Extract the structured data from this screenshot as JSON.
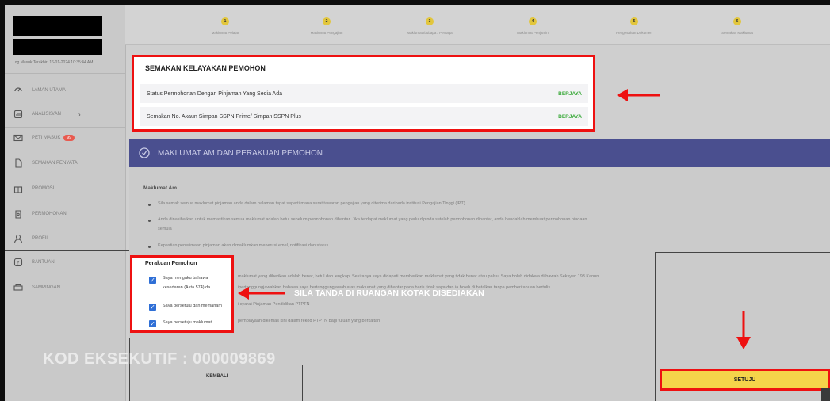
{
  "colors": {
    "accent_red": "#ee1111",
    "header_blue": "#4a4f8f",
    "success_green": "#3caa3c",
    "button_yellow": "#f5d44a",
    "checkbox_blue": "#2f6fd6"
  },
  "sidebar": {
    "last_login": "Log Masuk Terakhir: 16-01-2024 10:35:44 AM",
    "items": [
      {
        "label": "LAMAN UTAMA",
        "icon": "dashboard-icon"
      },
      {
        "label": "ANALISIS/AN",
        "icon": "chart-icon",
        "has_chevron": true
      },
      {
        "label": "PETI MASUK",
        "icon": "mail-icon",
        "badge": "99"
      },
      {
        "label": "SEMAKAN PENYATA",
        "icon": "document-icon"
      },
      {
        "label": "PROMOSI",
        "icon": "gift-icon"
      },
      {
        "label": "PERMOHONAN",
        "icon": "wallet-icon"
      },
      {
        "label": "PROFIL",
        "icon": "user-icon"
      },
      {
        "label": "BANTUAN",
        "icon": "help-icon"
      },
      {
        "label": "SAMPINGAN",
        "icon": "printer-icon"
      }
    ]
  },
  "stepper": {
    "steps": [
      {
        "num": "1",
        "label": "Maklumat Pelajar"
      },
      {
        "num": "2",
        "label": "Maklumat Pengajian"
      },
      {
        "num": "3",
        "label": "Maklumat Ibubapa / Penjaga"
      },
      {
        "num": "4",
        "label": "Maklumat Penjamin"
      },
      {
        "num": "5",
        "label": "Pengesahan Dokumen"
      },
      {
        "num": "6",
        "label": "Semakan Maklumat"
      }
    ]
  },
  "status_panel": {
    "title": "SEMAKAN KELAYAKAN PEMOHON",
    "rows": [
      {
        "label": "Status Permohonan Dengan Pinjaman Yang Sedia Ada",
        "status": "BERJAYA"
      },
      {
        "label": "Semakan No. Akaun Simpan SSPN Prime/ Simpan SSPN Plus",
        "status": "BERJAYA"
      }
    ]
  },
  "section": {
    "title": "MAKLUMAT AM DAN PERAKUAN PEMOHON",
    "general_heading": "Maklumat Am",
    "bullets": [
      "Sila semak semua maklumat pinjaman anda dalam halaman tepat seperti mana surat tawaran pengajian yang diterima daripada institusi Pengajian Tinggi (IPT)",
      "Anda dinasihatkan untuk memastikan semua maklumat adalah betul sebelum permohonan dihantar. Jika terdapat maklumat yang perlu dipinda setelah permohonan dihantar, anda hendaklah membuat permohonan pindaan",
      "semula",
      "Kepastian penerimaan pinjaman akan dimaklumkan menerusi emel, notifikasi dan status"
    ],
    "agreement_heading": "Perakuan Pemohon",
    "agreements": [
      {
        "text_visible": "Saya mengaku bahawa",
        "text_visible_2": "kesedaran (Akta 574) da",
        "text_rest": "maklumat yang diberikan adalah benar, betul dan lengkap. Sekiranya saya didapati memberikan maklumat yang tidak benar atau palsu, Saya boleh didakwa di bawah Seksyen 193 Kanun",
        "text_rest_2": "ipertanggungjawabkan bahawa saya bertanggungjawab atas maklumat yang dihantar pada baris tidak saya dan ia boleh di batalkan tanpa pemberitahuan bertulis",
        "checked": true
      },
      {
        "text_visible": "Saya bersetuju dan memaham",
        "text_rest": "i syarat Pinjaman Pendidikan PTPTN",
        "checked": true
      },
      {
        "text_visible": "Saya bersetuju maklumat",
        "text_rest": "pembiayaan dikemas kini dalam rekod PTPTN bagi tujuan yang berkaitan",
        "checked": true
      }
    ]
  },
  "annotations": {
    "checkbox_instruction": "SILA TANDA DI RUANGAN KOTAK DISEDIAKAN",
    "executive_code": "KOD EKSEKUTIF : 000009869"
  },
  "buttons": {
    "back": "KEMBALI",
    "agree": "SETUJU"
  }
}
